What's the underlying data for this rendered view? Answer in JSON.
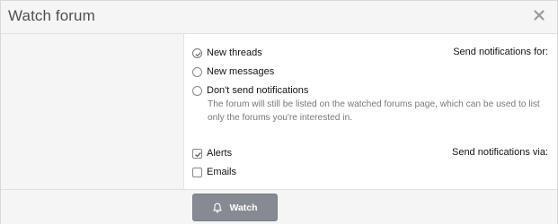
{
  "dialog": {
    "title": "Watch forum",
    "close_icon": "close-icon"
  },
  "send_for": {
    "label": "Send notifications for:",
    "options": [
      {
        "label": "New threads",
        "checked": true
      },
      {
        "label": "New messages",
        "checked": false
      },
      {
        "label": "Don't send notifications",
        "checked": false
      }
    ],
    "hint": "The forum will still be listed on the watched forums page, which can be used to list only the forums you're interested in."
  },
  "send_via": {
    "label": "Send notifications via:",
    "options": [
      {
        "label": "Alerts",
        "checked": true
      },
      {
        "label": "Emails",
        "checked": false
      }
    ]
  },
  "footer": {
    "watch_label": "Watch",
    "watch_icon": "bell-icon"
  },
  "colors": {
    "button_bg": "#868b93",
    "panel_bg": "#f5f5f5",
    "hint_text": "#7a7a7a"
  }
}
